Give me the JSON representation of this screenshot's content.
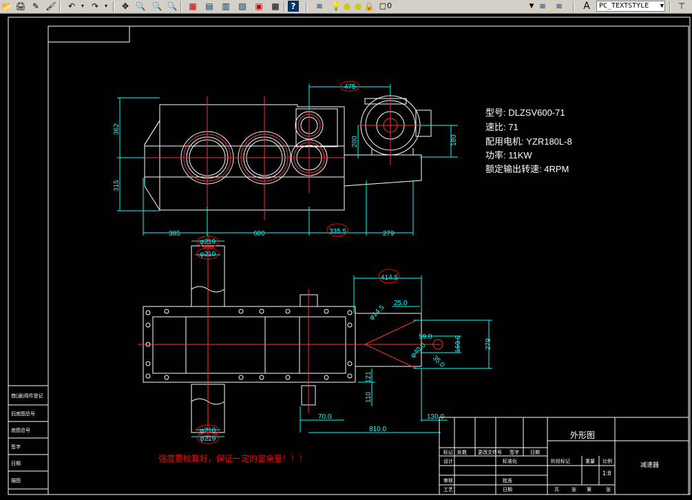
{
  "toolbar": {
    "text_style": "PC_TEXTSTYLE",
    "layer_value": "0",
    "icons": [
      "undo-icon",
      "redo-icon",
      "pan-icon",
      "zoom-realtime-icon",
      "zoom-window-icon",
      "zoom-previous-icon",
      "properties-icon",
      "design-center-icon",
      "tool-palettes-icon",
      "sheet-set-icon",
      "markup-icon",
      "calculator-icon",
      "help-icon",
      "layer-manager-icon",
      "lightbulb-icon",
      "sun-icon",
      "lock-icon"
    ]
  },
  "specs": {
    "model": "型号: DLZSV600-71",
    "ratio": "速比: 71",
    "motor": "配用电机: YZR180L-8",
    "power": "功率: 11KW",
    "output_speed": "额定输出转速: 4RPM"
  },
  "dims_top": {
    "d475": "475",
    "d362": "362",
    "d315": "315",
    "d200": "200",
    "d180": "180",
    "d385": "385",
    "d600": "600",
    "d3355": "335.5",
    "d279": "279"
  },
  "dims_bottom": {
    "phi219_top": "φ219",
    "phi210_top": "φ210",
    "d4145": "414.5",
    "phi145": "φ14.5",
    "d250": "25.0",
    "d590": "59.0",
    "phi400": "φ40.0",
    "d1600": "160.0",
    "d279b": "279",
    "d350": "35.0",
    "d121": "121",
    "d110": "110",
    "d700": "70.0",
    "d1300": "130.0",
    "d8100": "810.0",
    "phi210_bot": "φ210",
    "phi219_bot": "φ219"
  },
  "note": "强度要校算好，保证一定的富余量！！！",
  "title_block": {
    "drawing_name": "外形图",
    "product_name": "减速器",
    "scale": "1:8",
    "cells": [
      "标记",
      "处数",
      "更改文件号",
      "签字",
      "日期",
      "设计",
      "标准化",
      "审核",
      "工艺",
      "日期",
      "阶段标记",
      "重量",
      "比例",
      "共",
      "张",
      "第",
      "张",
      "批准"
    ]
  },
  "left_block": {
    "rows": [
      "借(通)用件登记",
      "旧底图总号",
      "底图总号",
      "签字",
      "日期",
      "描图",
      "校对"
    ]
  }
}
